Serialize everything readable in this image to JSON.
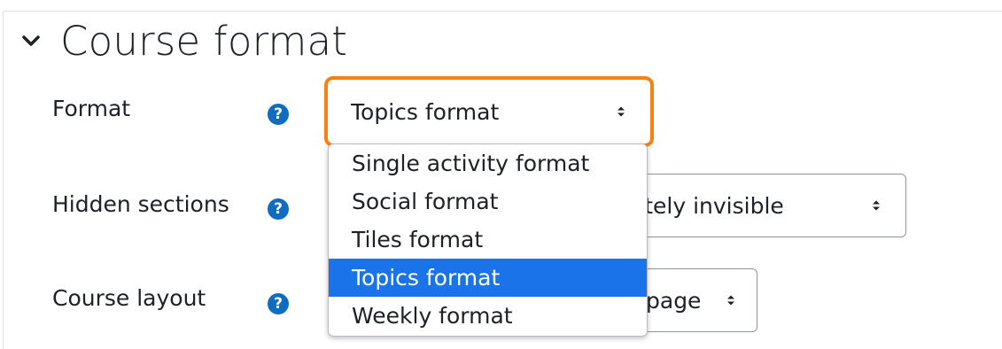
{
  "section": {
    "title": "Course format",
    "toggle_icon": "chevron-down-icon"
  },
  "fields": {
    "format": {
      "label": "Format",
      "value": "Topics format",
      "help_icon": "question-circle-icon",
      "options": [
        "Single activity format",
        "Social format",
        "Tiles format",
        "Topics format",
        "Weekly format"
      ],
      "selected_index": 3
    },
    "hidden_sections": {
      "label": "Hidden sections",
      "value_visible": "pletely invisible",
      "help_icon": "question-circle-icon"
    },
    "course_layout": {
      "label": "Course layout",
      "value_visible": "page",
      "help_icon": "question-circle-icon"
    }
  },
  "colors": {
    "focus_outline": "#f98012",
    "help_icon": "#0f6cbf",
    "selected_option": "#1a73e8",
    "text": "#1d2125"
  }
}
